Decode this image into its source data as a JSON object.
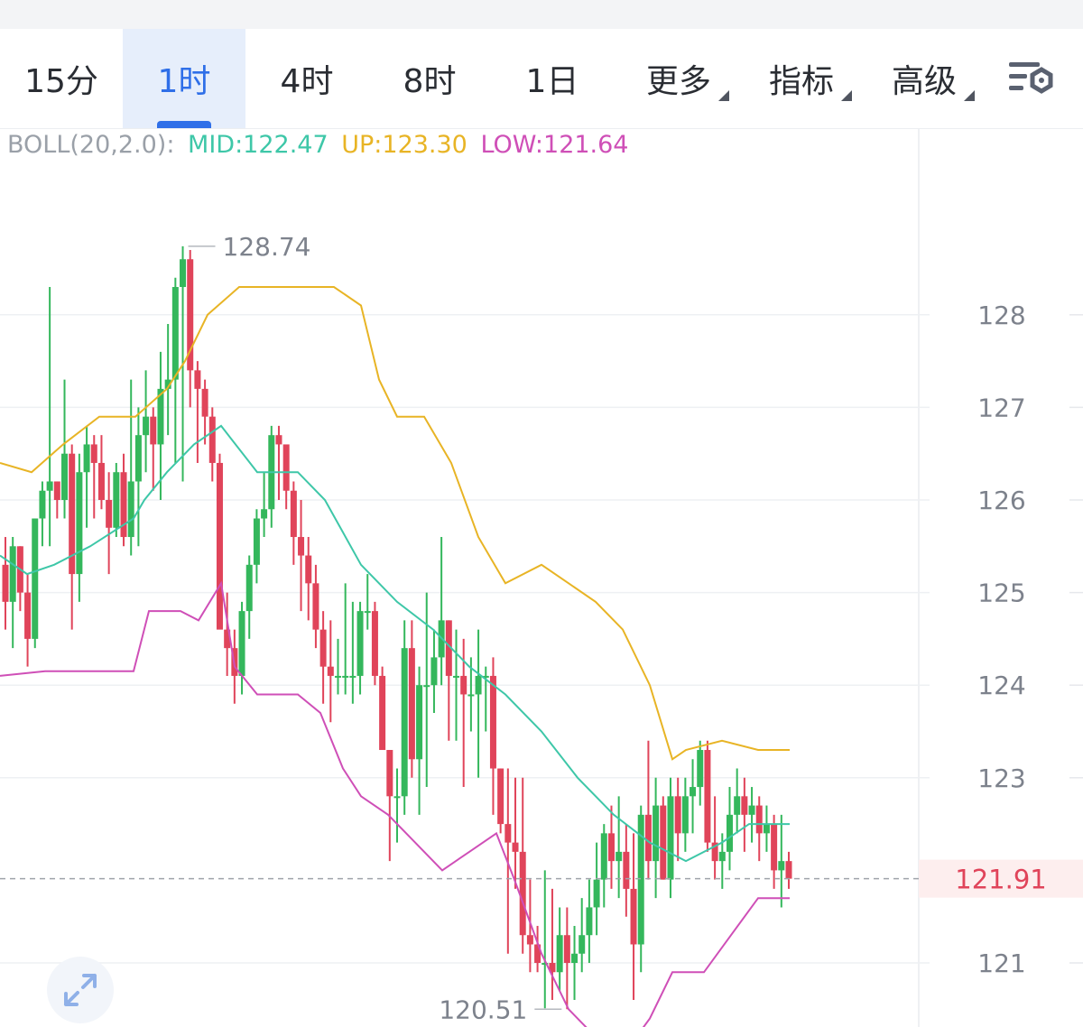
{
  "tabs": [
    {
      "label": "15分",
      "active": false,
      "dropdown": false
    },
    {
      "label": "1时",
      "active": true,
      "dropdown": false
    },
    {
      "label": "4时",
      "active": false,
      "dropdown": false
    },
    {
      "label": "8时",
      "active": false,
      "dropdown": false
    },
    {
      "label": "1日",
      "active": false,
      "dropdown": false
    },
    {
      "label": "更多",
      "active": false,
      "dropdown": true
    },
    {
      "label": "指标",
      "active": false,
      "dropdown": true
    },
    {
      "label": "高级",
      "active": false,
      "dropdown": true
    }
  ],
  "icons": {
    "settings": "chart-settings-icon",
    "expand": "expand-arrows-icon"
  },
  "colors": {
    "up": "#34b75c",
    "down": "#e0445a",
    "mid": "#3ec7a8",
    "upper": "#e8b425",
    "lower": "#cf4fb7",
    "accent": "#2f6fe8",
    "axis_text": "#7d828c"
  },
  "indicator": {
    "name": "BOLL(20,2.0):",
    "mid_label": "MID:122.47",
    "up_label": "UP:123.30",
    "low_label": "LOW:121.64"
  },
  "chart_data": {
    "type": "candlestick",
    "interval": "1时",
    "y_axis": {
      "ticks": [
        121,
        123,
        124,
        125,
        126,
        127,
        128
      ],
      "range": [
        120.3,
        129.1
      ],
      "side": "right"
    },
    "current_price": "121.91",
    "max_label": "128.74",
    "min_label": "120.51",
    "candles": [
      [
        125.3,
        125.6,
        124.6,
        124.9
      ],
      [
        124.9,
        125.6,
        124.4,
        125.5
      ],
      [
        125.5,
        125.5,
        124.8,
        125.0
      ],
      [
        125.0,
        125.2,
        124.2,
        124.5
      ],
      [
        124.5,
        125.8,
        124.4,
        125.8
      ],
      [
        125.8,
        126.2,
        125.5,
        126.1
      ],
      [
        126.1,
        128.3,
        125.5,
        126.2
      ],
      [
        126.2,
        126.2,
        125.8,
        126.0
      ],
      [
        126.0,
        127.3,
        125.8,
        126.5
      ],
      [
        126.5,
        126.6,
        124.6,
        125.2
      ],
      [
        125.2,
        126.5,
        124.9,
        126.3
      ],
      [
        126.3,
        126.8,
        125.7,
        126.6
      ],
      [
        126.6,
        126.7,
        125.8,
        126.4
      ],
      [
        126.4,
        126.7,
        125.9,
        126.0
      ],
      [
        126.0,
        126.3,
        125.2,
        125.7
      ],
      [
        125.7,
        126.4,
        125.6,
        126.3
      ],
      [
        126.3,
        126.5,
        125.5,
        125.6
      ],
      [
        125.6,
        127.3,
        125.4,
        126.2
      ],
      [
        126.2,
        127.0,
        125.5,
        126.7
      ],
      [
        126.7,
        127.4,
        126.3,
        126.9
      ],
      [
        126.9,
        127.0,
        126.1,
        126.6
      ],
      [
        126.6,
        127.6,
        126.0,
        127.2
      ],
      [
        127.2,
        127.9,
        126.7,
        127.3
      ],
      [
        127.3,
        128.4,
        126.4,
        128.3
      ],
      [
        128.3,
        128.74,
        126.2,
        128.6
      ],
      [
        128.6,
        128.7,
        127.0,
        127.4
      ],
      [
        127.4,
        127.5,
        126.4,
        127.2
      ],
      [
        127.2,
        127.3,
        126.6,
        126.9
      ],
      [
        126.9,
        127.0,
        126.2,
        126.4
      ],
      [
        126.4,
        126.5,
        124.9,
        124.6
      ],
      [
        124.6,
        125.0,
        124.1,
        124.4
      ],
      [
        124.4,
        124.6,
        123.8,
        124.1
      ],
      [
        124.1,
        124.9,
        123.9,
        124.8
      ],
      [
        124.8,
        125.4,
        124.5,
        125.3
      ],
      [
        125.3,
        125.9,
        125.1,
        125.8
      ],
      [
        125.8,
        126.3,
        125.6,
        125.9
      ],
      [
        125.9,
        126.8,
        125.7,
        126.7
      ],
      [
        126.7,
        126.8,
        126.0,
        126.6
      ],
      [
        126.6,
        126.6,
        125.9,
        126.1
      ],
      [
        126.1,
        126.2,
        125.3,
        125.6
      ],
      [
        125.6,
        126.0,
        124.8,
        125.4
      ],
      [
        125.4,
        125.6,
        124.7,
        125.1
      ],
      [
        125.1,
        125.3,
        124.4,
        124.6
      ],
      [
        124.6,
        124.8,
        123.8,
        124.2
      ],
      [
        124.2,
        124.7,
        123.6,
        124.1
      ],
      [
        124.1,
        124.5,
        123.9,
        124.1
      ],
      [
        124.1,
        125.1,
        123.9,
        124.1
      ],
      [
        124.1,
        124.9,
        123.8,
        124.1
      ],
      [
        124.1,
        124.9,
        123.9,
        124.8
      ],
      [
        124.8,
        125.2,
        124.6,
        124.8
      ],
      [
        124.8,
        124.9,
        124.0,
        124.1
      ],
      [
        124.1,
        124.2,
        123.3,
        123.3
      ],
      [
        123.3,
        123.3,
        122.1,
        122.8
      ],
      [
        122.8,
        123.1,
        122.3,
        122.8
      ],
      [
        122.8,
        124.7,
        122.6,
        124.4
      ],
      [
        124.4,
        124.7,
        123.0,
        123.2
      ],
      [
        123.2,
        124.2,
        122.6,
        124.0
      ],
      [
        124.0,
        125.0,
        122.9,
        124.0
      ],
      [
        124.0,
        124.6,
        123.7,
        124.3
      ],
      [
        124.3,
        125.6,
        124.0,
        124.7
      ],
      [
        124.7,
        124.7,
        123.4,
        124.1
      ],
      [
        124.1,
        124.6,
        123.4,
        124.1
      ],
      [
        124.1,
        124.5,
        122.9,
        123.9
      ],
      [
        123.9,
        124.3,
        123.5,
        123.9
      ],
      [
        123.9,
        124.6,
        123.0,
        124.1
      ],
      [
        124.1,
        124.2,
        123.5,
        124.1
      ],
      [
        124.1,
        124.3,
        122.6,
        123.1
      ],
      [
        123.1,
        123.1,
        122.4,
        122.5
      ],
      [
        122.5,
        123.1,
        121.1,
        122.3
      ],
      [
        122.3,
        123.0,
        121.8,
        122.2
      ],
      [
        122.2,
        123.0,
        121.1,
        121.3
      ],
      [
        121.3,
        121.9,
        120.9,
        121.2
      ],
      [
        121.2,
        121.4,
        120.9,
        121.0
      ],
      [
        121.0,
        122.0,
        120.51,
        121.0
      ],
      [
        121.0,
        121.8,
        120.6,
        120.9
      ],
      [
        120.9,
        121.6,
        120.7,
        121.3
      ],
      [
        121.3,
        121.6,
        120.5,
        121.0
      ],
      [
        121.0,
        121.4,
        120.6,
        121.1
      ],
      [
        121.1,
        121.7,
        120.9,
        121.3
      ],
      [
        121.3,
        121.9,
        121.0,
        121.6
      ],
      [
        121.6,
        122.3,
        121.3,
        121.9
      ],
      [
        121.9,
        122.5,
        121.6,
        122.4
      ],
      [
        122.4,
        122.7,
        121.8,
        122.1
      ],
      [
        122.1,
        122.8,
        121.7,
        122.2
      ],
      [
        122.2,
        122.5,
        121.5,
        121.8
      ],
      [
        121.8,
        122.4,
        120.6,
        121.2
      ],
      [
        121.2,
        122.7,
        120.9,
        122.6
      ],
      [
        122.6,
        123.4,
        121.9,
        122.1
      ],
      [
        122.1,
        123.0,
        121.7,
        122.7
      ],
      [
        122.7,
        122.8,
        121.9,
        121.9
      ],
      [
        121.9,
        123.0,
        121.7,
        122.8
      ],
      [
        122.8,
        123.0,
        122.1,
        122.4
      ],
      [
        122.4,
        123.0,
        122.2,
        122.8
      ],
      [
        122.8,
        123.2,
        122.4,
        122.9
      ],
      [
        122.9,
        123.4,
        122.7,
        123.3
      ],
      [
        123.3,
        123.4,
        122.2,
        122.3
      ],
      [
        122.3,
        122.8,
        121.9,
        122.1
      ],
      [
        122.1,
        122.4,
        121.8,
        122.2
      ],
      [
        122.2,
        122.9,
        122.0,
        122.6
      ],
      [
        122.6,
        123.1,
        122.4,
        122.8
      ],
      [
        122.8,
        123.0,
        122.2,
        122.6
      ],
      [
        122.6,
        122.9,
        122.3,
        122.7
      ],
      [
        122.7,
        122.8,
        122.1,
        122.4
      ],
      [
        122.4,
        122.7,
        122.2,
        122.5
      ],
      [
        122.5,
        122.6,
        121.8,
        122.0
      ],
      [
        122.0,
        122.6,
        121.6,
        122.1
      ],
      [
        122.1,
        122.2,
        121.8,
        121.91
      ]
    ],
    "boll_mid": [
      [
        0,
        125.4
      ],
      [
        30,
        125.2
      ],
      [
        60,
        125.3
      ],
      [
        100,
        125.5
      ],
      [
        148,
        125.8
      ],
      [
        160,
        126.0
      ],
      [
        185,
        126.3
      ],
      [
        215,
        126.6
      ],
      [
        245,
        126.8
      ],
      [
        285,
        126.3
      ],
      [
        330,
        126.3
      ],
      [
        360,
        126.0
      ],
      [
        400,
        125.3
      ],
      [
        440,
        124.9
      ],
      [
        480,
        124.6
      ],
      [
        520,
        124.2
      ],
      [
        560,
        123.9
      ],
      [
        600,
        123.5
      ],
      [
        640,
        123.0
      ],
      [
        680,
        122.6
      ],
      [
        720,
        122.3
      ],
      [
        760,
        122.1
      ],
      [
        800,
        122.3
      ],
      [
        830,
        122.5
      ],
      [
        875,
        122.5
      ]
    ],
    "boll_upper": [
      [
        0,
        126.4
      ],
      [
        35,
        126.3
      ],
      [
        70,
        126.6
      ],
      [
        110,
        126.9
      ],
      [
        150,
        126.9
      ],
      [
        185,
        127.2
      ],
      [
        205,
        127.5
      ],
      [
        230,
        128.0
      ],
      [
        265,
        128.3
      ],
      [
        300,
        128.3
      ],
      [
        340,
        128.3
      ],
      [
        370,
        128.3
      ],
      [
        400,
        128.1
      ],
      [
        420,
        127.3
      ],
      [
        440,
        126.9
      ],
      [
        470,
        126.9
      ],
      [
        500,
        126.4
      ],
      [
        530,
        125.6
      ],
      [
        560,
        125.1
      ],
      [
        600,
        125.3
      ],
      [
        630,
        125.1
      ],
      [
        660,
        124.9
      ],
      [
        690,
        124.6
      ],
      [
        720,
        124.0
      ],
      [
        745,
        123.2
      ],
      [
        760,
        123.3
      ],
      [
        800,
        123.4
      ],
      [
        840,
        123.3
      ],
      [
        875,
        123.3
      ]
    ],
    "boll_lower": [
      [
        0,
        124.1
      ],
      [
        50,
        124.15
      ],
      [
        100,
        124.15
      ],
      [
        148,
        124.15
      ],
      [
        165,
        124.8
      ],
      [
        200,
        124.8
      ],
      [
        220,
        124.7
      ],
      [
        245,
        125.1
      ],
      [
        260,
        124.2
      ],
      [
        285,
        123.9
      ],
      [
        330,
        123.9
      ],
      [
        355,
        123.7
      ],
      [
        380,
        123.1
      ],
      [
        400,
        122.8
      ],
      [
        430,
        122.6
      ],
      [
        460,
        122.3
      ],
      [
        490,
        122.0
      ],
      [
        520,
        122.2
      ],
      [
        550,
        122.4
      ],
      [
        570,
        121.9
      ],
      [
        600,
        121.1
      ],
      [
        630,
        120.5
      ],
      [
        660,
        120.2
      ],
      [
        690,
        120.0
      ],
      [
        720,
        120.4
      ],
      [
        745,
        120.9
      ],
      [
        780,
        120.9
      ],
      [
        810,
        121.3
      ],
      [
        840,
        121.7
      ],
      [
        875,
        121.7
      ]
    ]
  }
}
